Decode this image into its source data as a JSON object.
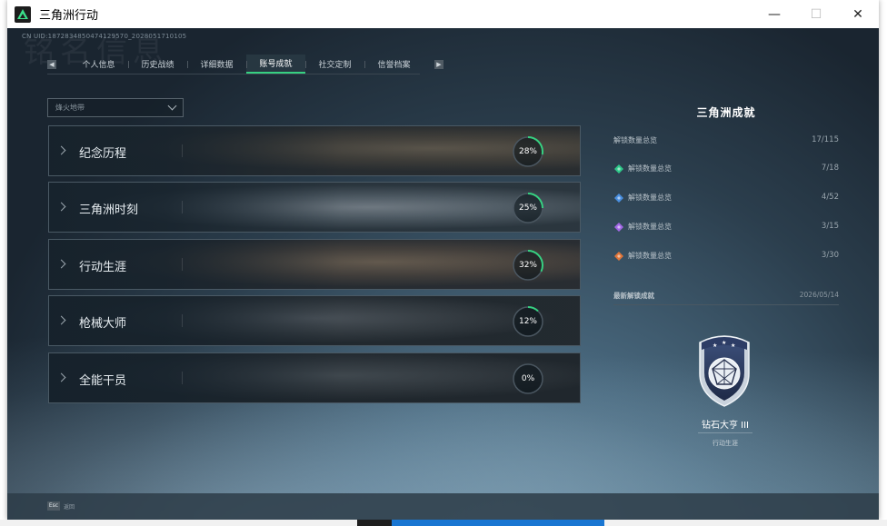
{
  "window": {
    "title": "三角洲行动",
    "controls": {
      "minimize": "—",
      "maximize": "☐",
      "close": "✕"
    }
  },
  "header": {
    "uid": "CN UID:1872834850474129570_2028051710105",
    "bg_title": "铭名信息"
  },
  "tabs": [
    {
      "label": "个人信息",
      "active": false
    },
    {
      "label": "历史战绩",
      "active": false
    },
    {
      "label": "详细数据",
      "active": false
    },
    {
      "label": "账号成就",
      "active": true
    },
    {
      "label": "社交定制",
      "active": false
    },
    {
      "label": "信誉档案",
      "active": false
    }
  ],
  "tab_arrows": {
    "left": "◀",
    "right": "▶"
  },
  "filter": {
    "label": "烽火地带"
  },
  "categories": [
    {
      "name": "纪念历程",
      "percent": 28,
      "percent_label": "28%"
    },
    {
      "name": "三角洲时刻",
      "percent": 25,
      "percent_label": "25%"
    },
    {
      "name": "行动生涯",
      "percent": 32,
      "percent_label": "32%"
    },
    {
      "name": "枪械大师",
      "percent": 12,
      "percent_label": "12%"
    },
    {
      "name": "全能干员",
      "percent": 0,
      "percent_label": "0%"
    }
  ],
  "panel": {
    "title": "三角洲成就",
    "total": {
      "label": "解锁数量总览",
      "value": "17/115"
    },
    "tiers": [
      {
        "label": "解锁数量总览",
        "value": "7/18",
        "icon": "green-gem-icon",
        "color": "#2fc98a"
      },
      {
        "label": "解锁数量总览",
        "value": "4/52",
        "icon": "blue-gem-icon",
        "color": "#4a8fe0"
      },
      {
        "label": "解锁数量总览",
        "value": "3/15",
        "icon": "purple-gem-icon",
        "color": "#a368e6"
      },
      {
        "label": "解锁数量总览",
        "value": "3/30",
        "icon": "orange-gem-icon",
        "color": "#e0763a"
      }
    ],
    "recent": {
      "label": "最新解锁成就",
      "date": "2026/05/14"
    },
    "badge": {
      "name": "钻石大亨 III",
      "category": "行动生涯",
      "icon": "diamond-shield-badge-icon"
    }
  },
  "bottom": {
    "key": "Esc",
    "label": "返回"
  },
  "colors": {
    "accent": "#36d081",
    "ring_track": "#4a5660"
  }
}
